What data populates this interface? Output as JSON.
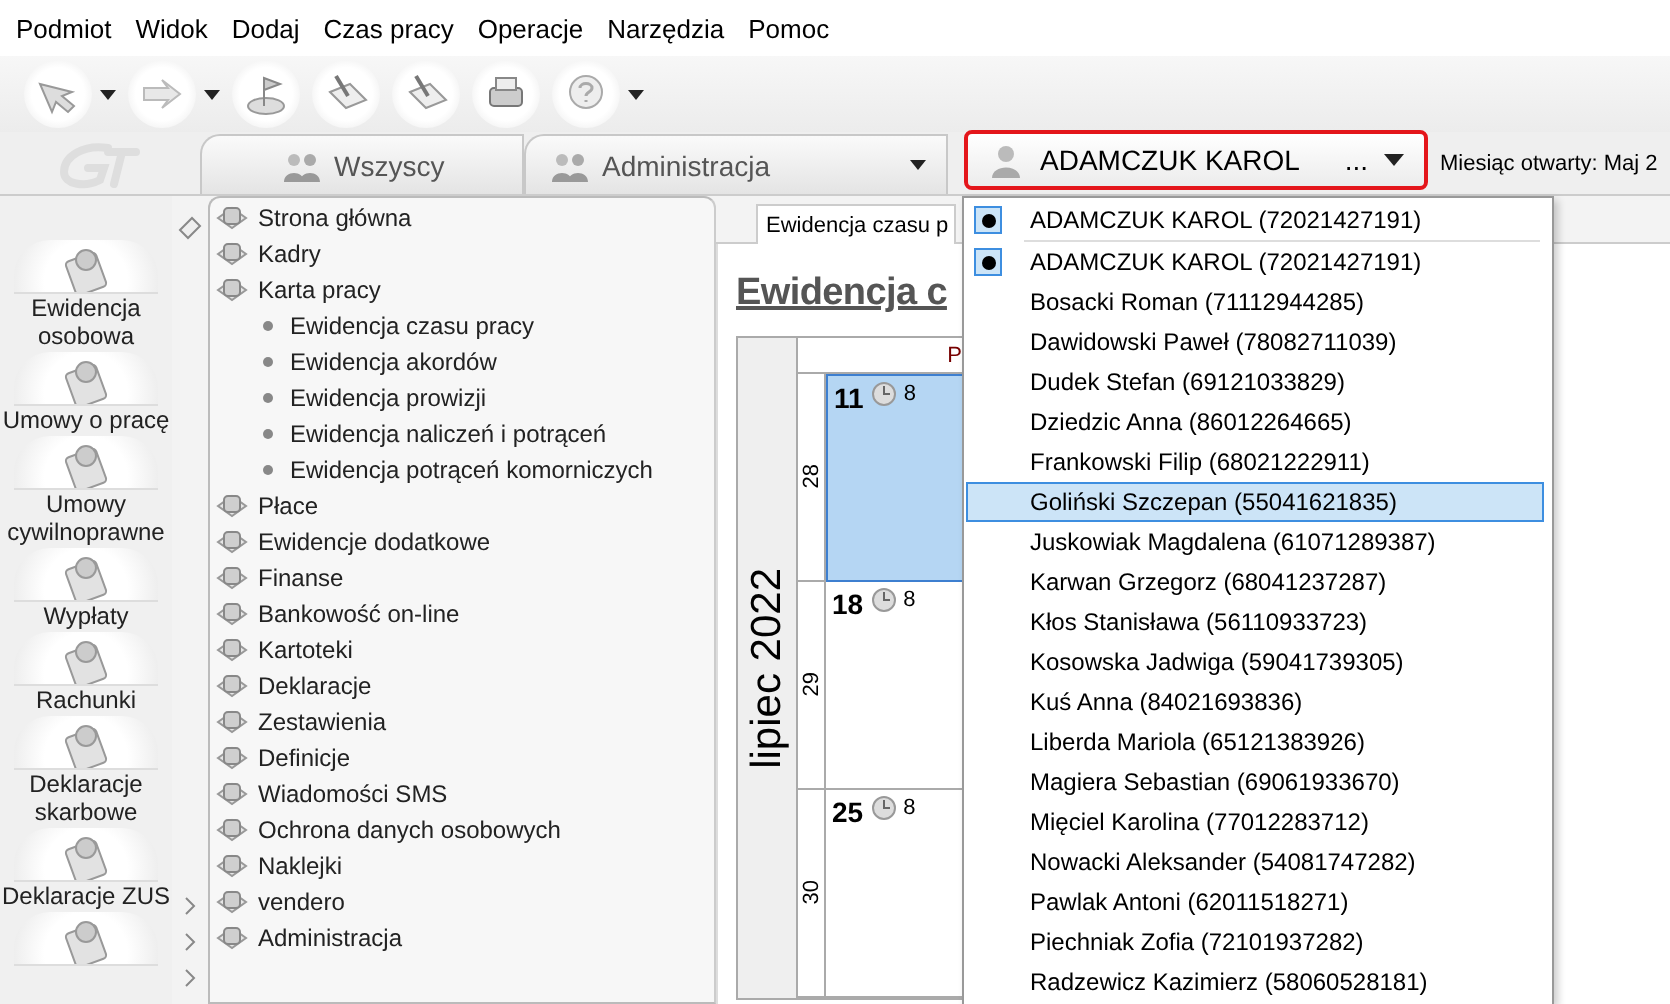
{
  "menu": [
    {
      "label": "Podmiot"
    },
    {
      "label": "Widok"
    },
    {
      "label": "Dodaj"
    },
    {
      "label": "Czas pracy"
    },
    {
      "label": "Operacje"
    },
    {
      "label": "Narzędzia"
    },
    {
      "label": "Pomoc"
    }
  ],
  "tabs": [
    {
      "label": "Wszyscy",
      "kind": "plain"
    },
    {
      "label": "Administracja",
      "kind": "dropdown"
    }
  ],
  "employee_selector": {
    "value": "ADAMCZUK KAROL",
    "more": "...",
    "highlighted": true
  },
  "month_status": {
    "label": "Miesiąc otwarty:",
    "value": "Maj 2"
  },
  "side_buttons": [
    {
      "label": "Ewidencja osobowa"
    },
    {
      "label": "Umowy o pracę"
    },
    {
      "label": "Umowy cywilnoprawne"
    },
    {
      "label": "Wypłaty"
    },
    {
      "label": "Rachunki"
    },
    {
      "label": "Deklaracje skarbowe"
    },
    {
      "label": "Deklaracje ZUS"
    },
    {
      "icon_only": true
    }
  ],
  "nav_tree": [
    {
      "label": "Strona główna"
    },
    {
      "label": "Kadry"
    },
    {
      "label": "Karta pracy",
      "children": [
        {
          "label": "Ewidencja czasu pracy"
        },
        {
          "label": "Ewidencja akordów"
        },
        {
          "label": "Ewidencja prowizji"
        },
        {
          "label": "Ewidencja naliczeń i potrąceń"
        },
        {
          "label": "Ewidencja potrąceń komorniczych"
        }
      ]
    },
    {
      "label": "Płace"
    },
    {
      "label": "Ewidencje dodatkowe"
    },
    {
      "label": "Finanse"
    },
    {
      "label": "Bankowość on-line"
    },
    {
      "label": "Kartoteki"
    },
    {
      "label": "Deklaracje"
    },
    {
      "label": "Zestawienia"
    },
    {
      "label": "Definicje"
    },
    {
      "label": "Wiadomości SMS"
    },
    {
      "label": "Ochrona danych osobowych"
    },
    {
      "label": "Naklejki"
    },
    {
      "label": "vendero"
    },
    {
      "label": "Administracja"
    }
  ],
  "document_tab": {
    "label": "Ewidencja czasu p"
  },
  "heading": "Ewidencja c",
  "calendar": {
    "month": "lipiec 2022",
    "header": "P",
    "weeks": [
      {
        "week": "28",
        "day": "11",
        "hours": "8",
        "selected": true
      },
      {
        "week": "29",
        "day": "18",
        "hours": "8",
        "selected": false
      },
      {
        "week": "30",
        "day": "25",
        "hours": "8",
        "selected": false
      }
    ]
  },
  "dropdown": {
    "current": {
      "label": "ADAMCZUK KAROL (72021427191)",
      "marked": true
    },
    "items": [
      {
        "label": "ADAMCZUK KAROL (72021427191)",
        "marked": true,
        "selected": false
      },
      {
        "label": "Bosacki Roman (71112944285)",
        "marked": false,
        "selected": false
      },
      {
        "label": "Dawidowski Paweł (78082711039)",
        "marked": false,
        "selected": false
      },
      {
        "label": "Dudek Stefan (69121033829)",
        "marked": false,
        "selected": false
      },
      {
        "label": "Dziedzic Anna (86012264665)",
        "marked": false,
        "selected": false
      },
      {
        "label": "Frankowski Filip (68021222911)",
        "marked": false,
        "selected": false
      },
      {
        "label": "Goliński Szczepan (55041621835)",
        "marked": false,
        "selected": true
      },
      {
        "label": "Juskowiak Magdalena (61071289387)",
        "marked": false,
        "selected": false
      },
      {
        "label": "Karwan Grzegorz (68041237287)",
        "marked": false,
        "selected": false
      },
      {
        "label": "Kłos Stanisława (56110933723)",
        "marked": false,
        "selected": false
      },
      {
        "label": "Kosowska Jadwiga (59041739305)",
        "marked": false,
        "selected": false
      },
      {
        "label": "Kuś Anna (84021693836)",
        "marked": false,
        "selected": false
      },
      {
        "label": "Liberda Mariola (65121383926)",
        "marked": false,
        "selected": false
      },
      {
        "label": "Magiera Sebastian (69061933670)",
        "marked": false,
        "selected": false
      },
      {
        "label": "Mięciel Karolina (77012283712)",
        "marked": false,
        "selected": false
      },
      {
        "label": "Nowacki Aleksander (54081747282)",
        "marked": false,
        "selected": false
      },
      {
        "label": "Pawlak Antoni (62011518271)",
        "marked": false,
        "selected": false
      },
      {
        "label": "Piechniak Zofia (72101937282)",
        "marked": false,
        "selected": false
      },
      {
        "label": "Radzewicz Kazimierz (58060528181)",
        "marked": false,
        "selected": false
      }
    ]
  }
}
